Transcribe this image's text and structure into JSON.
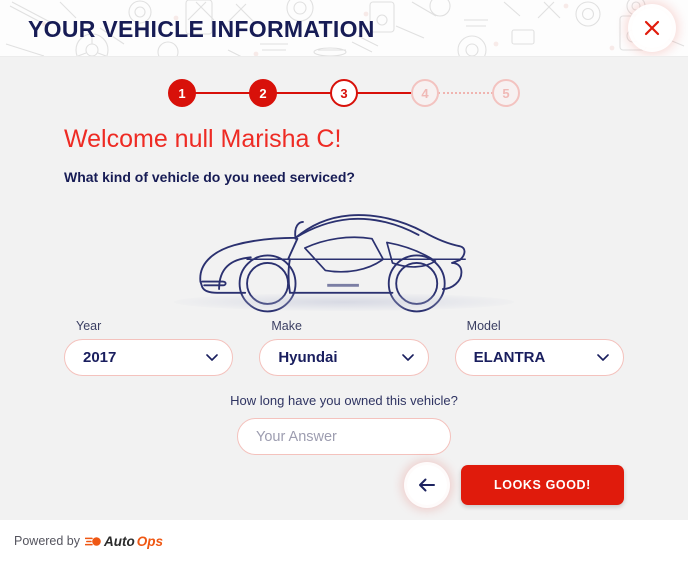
{
  "header": {
    "title": "YOUR VEHICLE INFORMATION",
    "close_label": "×",
    "close_icon": "close-icon"
  },
  "stepper": {
    "steps": [
      {
        "label": "1",
        "state": "done"
      },
      {
        "label": "2",
        "state": "done"
      },
      {
        "label": "3",
        "state": "current"
      },
      {
        "label": "4",
        "state": "todo"
      },
      {
        "label": "5",
        "state": "todo"
      }
    ],
    "connectors": [
      "solid",
      "solid",
      "solid",
      "dotted"
    ]
  },
  "main": {
    "welcome": "Welcome null Marisha C!",
    "question": "What kind of vehicle do you need serviced?",
    "illustration": "car-side-outline-illustration"
  },
  "fields": [
    {
      "label": "Year",
      "value": "2017",
      "name": "year-select",
      "icon": "chevron-down-icon"
    },
    {
      "label": "Make",
      "value": "Hyundai",
      "name": "make-select",
      "icon": "chevron-down-icon"
    },
    {
      "label": "Model",
      "value": "ELANTRA",
      "name": "model-select",
      "icon": "chevron-down-icon"
    }
  ],
  "owned": {
    "label": "How long have you owned this vehicle?",
    "value": "",
    "placeholder": "Your Answer"
  },
  "actions": {
    "back_icon": "arrow-left-icon",
    "back_label": "Back",
    "submit_label": "LOOKS GOOD!"
  },
  "footer": {
    "powered_by": "Powered by",
    "brand_first": "Auto",
    "brand_second": "Ops",
    "brand_icon": "autoops-speed-icon"
  },
  "colors": {
    "brand_red": "#e01b0c",
    "step_red": "#d8110a",
    "welcome_red": "#ee2b24",
    "navy": "#171c55",
    "field_border": "#f4c2bd",
    "body_bg": "#f2f2f2",
    "brand_orange": "#ef5713"
  }
}
